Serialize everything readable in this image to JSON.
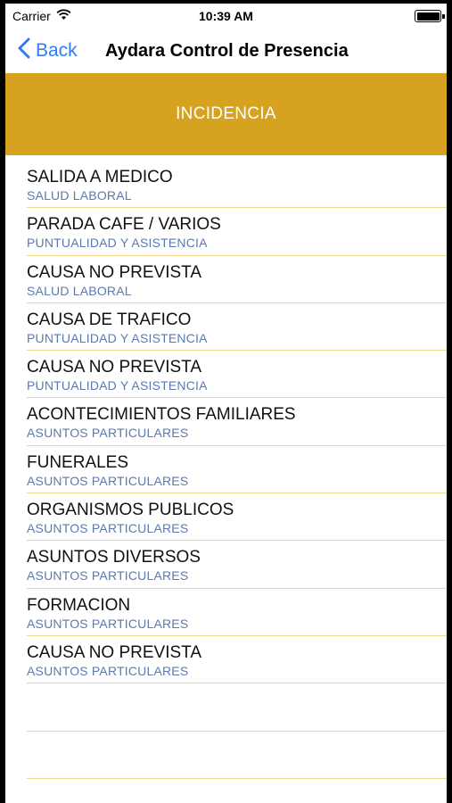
{
  "status_bar": {
    "carrier": "Carrier",
    "time": "10:39 AM"
  },
  "nav": {
    "back_label": "Back",
    "title": "Aydara Control de Presencia"
  },
  "banner": {
    "title": "INCIDENCIA",
    "color": "#d6a21f"
  },
  "items": [
    {
      "title": "SALIDA A MEDICO",
      "subtitle": "SALUD LABORAL"
    },
    {
      "title": "PARADA CAFE / VARIOS",
      "subtitle": "PUNTUALIDAD Y ASISTENCIA"
    },
    {
      "title": "CAUSA NO PREVISTA",
      "subtitle": "SALUD LABORAL"
    },
    {
      "title": "CAUSA DE TRAFICO",
      "subtitle": "PUNTUALIDAD Y ASISTENCIA"
    },
    {
      "title": "CAUSA NO PREVISTA",
      "subtitle": "PUNTUALIDAD Y ASISTENCIA"
    },
    {
      "title": "ACONTECIMIENTOS FAMILIARES",
      "subtitle": "ASUNTOS PARTICULARES"
    },
    {
      "title": "FUNERALES",
      "subtitle": "ASUNTOS PARTICULARES"
    },
    {
      "title": "ORGANISMOS PUBLICOS",
      "subtitle": "ASUNTOS PARTICULARES"
    },
    {
      "title": "ASUNTOS DIVERSOS",
      "subtitle": "ASUNTOS PARTICULARES"
    },
    {
      "title": "FORMACION",
      "subtitle": "ASUNTOS PARTICULARES"
    },
    {
      "title": "CAUSA NO PREVISTA",
      "subtitle": "ASUNTOS PARTICULARES"
    }
  ],
  "colors": {
    "accent": "#2f7cf6",
    "subtitle": "#5a7ab0",
    "separator": "#f0d78f"
  },
  "icons": {
    "back": "chevron-left-icon",
    "wifi": "wifi-icon",
    "battery": "battery-icon"
  }
}
